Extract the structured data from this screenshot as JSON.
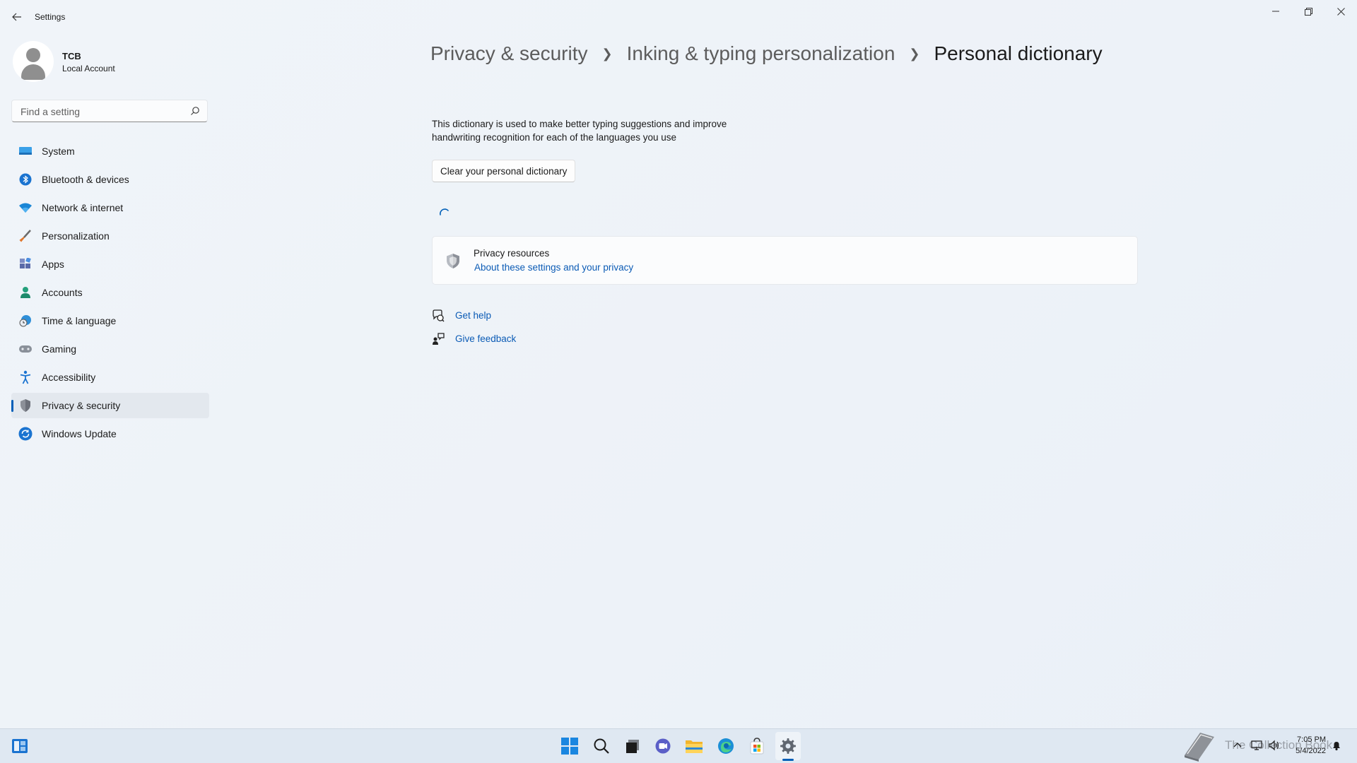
{
  "window": {
    "title": "Settings"
  },
  "profile": {
    "name": "TCB",
    "account_type": "Local Account"
  },
  "search": {
    "placeholder": "Find a setting",
    "value": ""
  },
  "sidebar": {
    "active_index": 9,
    "items": [
      {
        "label": "System",
        "icon": "system-icon"
      },
      {
        "label": "Bluetooth & devices",
        "icon": "bluetooth-icon"
      },
      {
        "label": "Network & internet",
        "icon": "wifi-icon"
      },
      {
        "label": "Personalization",
        "icon": "brush-icon"
      },
      {
        "label": "Apps",
        "icon": "apps-icon"
      },
      {
        "label": "Accounts",
        "icon": "person-icon"
      },
      {
        "label": "Time & language",
        "icon": "globe-clock-icon"
      },
      {
        "label": "Gaming",
        "icon": "gamepad-icon"
      },
      {
        "label": "Accessibility",
        "icon": "accessibility-icon"
      },
      {
        "label": "Privacy & security",
        "icon": "shield-icon"
      },
      {
        "label": "Windows Update",
        "icon": "update-icon"
      }
    ]
  },
  "breadcrumb": {
    "items": [
      "Privacy & security",
      "Inking & typing personalization",
      "Personal dictionary"
    ]
  },
  "main": {
    "description": "This dictionary is used to make better typing suggestions and improve handwriting recognition for each of the languages you use",
    "clear_button": "Clear your personal dictionary",
    "privacy_card": {
      "title": "Privacy resources",
      "link": "About these settings and your privacy"
    },
    "help": {
      "get_help": "Get help",
      "give_feedback": "Give feedback"
    }
  },
  "taskbar": {
    "apps": [
      "start-icon",
      "search-icon",
      "task-view-icon",
      "chat-icon",
      "file-explorer-icon",
      "edge-icon",
      "store-icon",
      "settings-icon"
    ],
    "active_app": "settings-icon",
    "clock_time": "7:05 PM",
    "clock_date": "5/4/2022",
    "watermark": "The Collection Book"
  },
  "colors": {
    "accent": "#005fb8",
    "link": "#0b5bb5",
    "background": "#eef3f9"
  }
}
